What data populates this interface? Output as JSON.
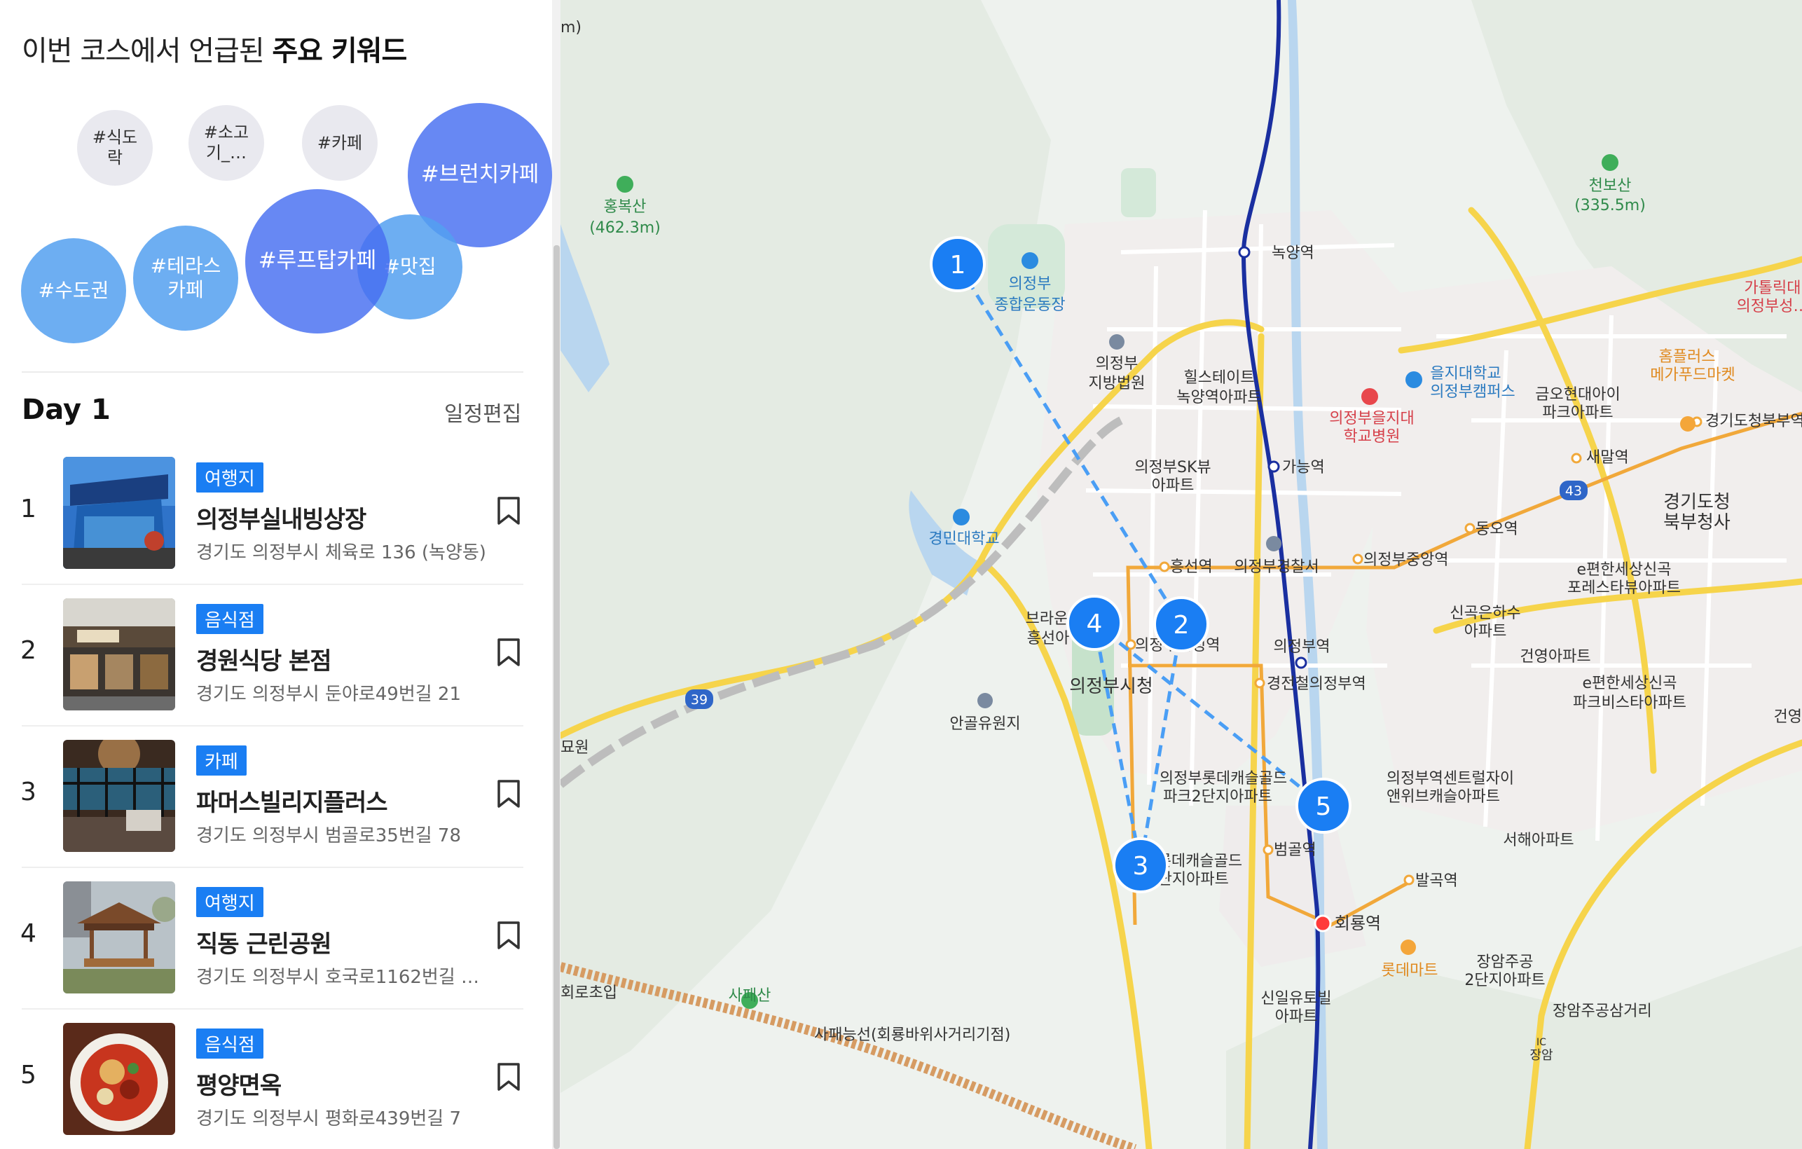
{
  "keywords": {
    "title_prefix": "이번 코스에서 언급된 ",
    "title_bold": "주요 키워드",
    "tags": [
      "#식도락",
      "#소고기_…",
      "#카페",
      "#브런치카페",
      "#수도권",
      "#테라스카페",
      "#루프탑카페",
      "#맛집"
    ]
  },
  "day": {
    "title": "Day 1",
    "edit_label": "일정편집"
  },
  "stops": [
    {
      "number": "1",
      "category": "여행지",
      "name": "의정부실내빙상장",
      "address": "경기도 의정부시 체육로 136 (녹양동)"
    },
    {
      "number": "2",
      "category": "음식점",
      "name": "경원식당 본점",
      "address": "경기도 의정부시 둔야로49번길 21"
    },
    {
      "number": "3",
      "category": "카페",
      "name": "파머스빌리지플러스",
      "address": "경기도 의정부시 범골로35번길 78"
    },
    {
      "number": "4",
      "category": "여행지",
      "name": "직동 근린공원",
      "address": "경기도 의정부시 호국로1162번길 …"
    },
    {
      "number": "5",
      "category": "음식점",
      "name": "평양면옥",
      "address": "경기도 의정부시 평화로439번길 7"
    }
  ],
  "map": {
    "markers": [
      "1",
      "2",
      "3",
      "4",
      "5"
    ],
    "labels": {
      "hongboksan": "홍복산",
      "hongboksan_h": "(462.3m)",
      "cheonbosan": "천보산",
      "cheonbosan_h": "(335.5m)",
      "sportscomplex1": "의정부",
      "sportscomplex2": "종합운동장",
      "nokyang": "녹양역",
      "court1": "의정부",
      "court2": "지방법원",
      "hills1": "힐스테이트",
      "hills2": "녹양역아파트",
      "eulji_univ1": "을지대학교",
      "eulji_univ2": "의정부캠퍼스",
      "eulji_hosp1": "의정부을지대",
      "eulji_hosp2": "학교병원",
      "geumo1": "금오현대아이",
      "geumo2": "파크아파트",
      "homeplus1": "홈플러스",
      "homeplus2": "메가푸드마켓",
      "gyeonggi_north_station": "경기도청북부역",
      "saemal": "새말역",
      "sk1": "의정부SK뷰",
      "sk2": "아파트",
      "ganeung": "가능역",
      "kyungmin": "경민대학교",
      "heungseon": "흥선역",
      "police": "의정부경찰서",
      "jungang": "의정부중앙역",
      "dongo": "동오역",
      "gov1": "경기도청",
      "gov2": "북부청사",
      "efeel1": "e편한세상신곡",
      "efeel2": "포레스타뷰아파트",
      "singok1": "신곡은하수",
      "singok2": "아파트",
      "geonyoung": "건영아파트",
      "efeel3": "e편한세상신곡",
      "efeel4": "파크비스타아파트",
      "brown1": "브라운",
      "brown2": "흥선아",
      "citystn": "의정부시청역",
      "uijeongbu_stn": "의정부역",
      "cityhall": "의정부시청",
      "gyeongjeon": "경전철의정부역",
      "angol": "안골유원지",
      "lotte1": "의정부롯데캐슬골드",
      "lotte2": "파크2단지아파트",
      "centreal1": "의정부역센트럴자이",
      "centreal2": "앤위브캐슬아파트",
      "seohae": "서해아파트",
      "beomgol": "범골역",
      "castle1": "의정부롯데캐슬골드",
      "castle2": "파크1단지아파트",
      "balgok": "발곡역",
      "hoeryong": "회룡역",
      "lottemart": "롯데마트",
      "jangam1": "장암주공",
      "jangam2": "2단지아파트",
      "sinil1": "신일유토빌",
      "sinil2": "아파트",
      "jangam_sam": "장암주공삼거리",
      "jangam": "장암",
      "sapaesan": "사패산",
      "sapae_line": "사패능선(회룡바위사거리기점)",
      "school": "회로초입",
      "myowon": "묘원",
      "m_left": "m)",
      "garosu1": "가톨릭대",
      "garosu2": "의정부성…",
      "geonyoung_right": "건영",
      "route43": "43",
      "route39": "39",
      "ic": "IC"
    }
  }
}
